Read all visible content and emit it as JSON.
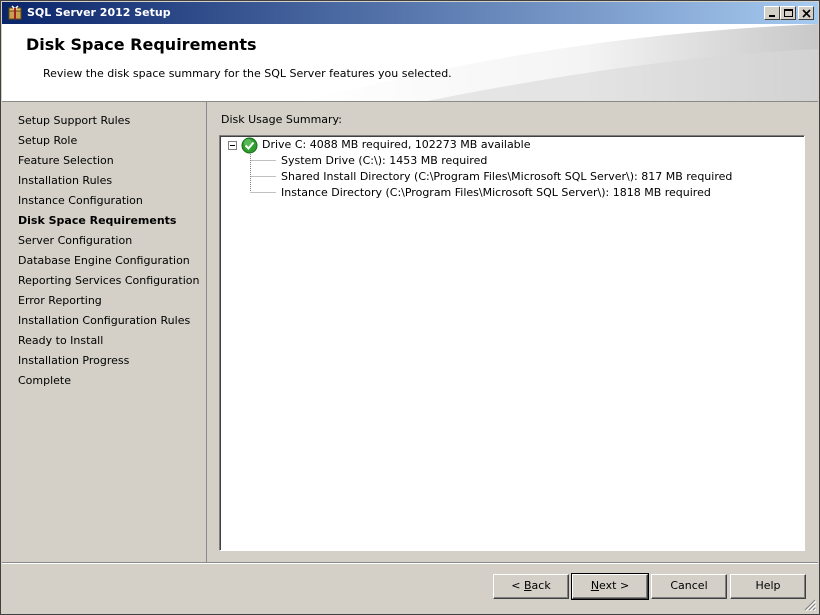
{
  "window": {
    "title": "SQL Server 2012 Setup"
  },
  "header": {
    "title": "Disk Space Requirements",
    "description": "Review the disk space summary for the SQL Server features you selected."
  },
  "sidebar": {
    "items": [
      {
        "label": "Setup Support Rules"
      },
      {
        "label": "Setup Role"
      },
      {
        "label": "Feature Selection"
      },
      {
        "label": "Installation Rules"
      },
      {
        "label": "Instance Configuration"
      },
      {
        "label": "Disk Space Requirements",
        "active": true
      },
      {
        "label": "Server Configuration"
      },
      {
        "label": "Database Engine Configuration"
      },
      {
        "label": "Reporting Services Configuration"
      },
      {
        "label": "Error Reporting"
      },
      {
        "label": "Installation Configuration Rules"
      },
      {
        "label": "Ready to Install"
      },
      {
        "label": "Installation Progress"
      },
      {
        "label": "Complete"
      }
    ]
  },
  "main": {
    "summary_label": "Disk Usage Summary:",
    "tree": {
      "root": "Drive C: 4088 MB required, 102273 MB available",
      "children": [
        "System Drive (C:\\): 1453 MB required",
        "Shared Install Directory (C:\\Program Files\\Microsoft SQL Server\\): 817 MB required",
        "Instance Directory (C:\\Program Files\\Microsoft SQL Server\\): 1818 MB required"
      ]
    }
  },
  "buttons": {
    "back_prefix": "< ",
    "back_hotkey": "B",
    "back_rest": "ack",
    "next_hotkey": "N",
    "next_rest": "ext >",
    "cancel": "Cancel",
    "help": "Help"
  },
  "icons": {
    "app": "sql-server-setup-icon",
    "status": "green-check-icon"
  },
  "colors": {
    "titlebar_start": "#0a246a",
    "titlebar_end": "#a6caf0",
    "window_bg": "#d4d0c8",
    "success": "#2e9e2e"
  }
}
